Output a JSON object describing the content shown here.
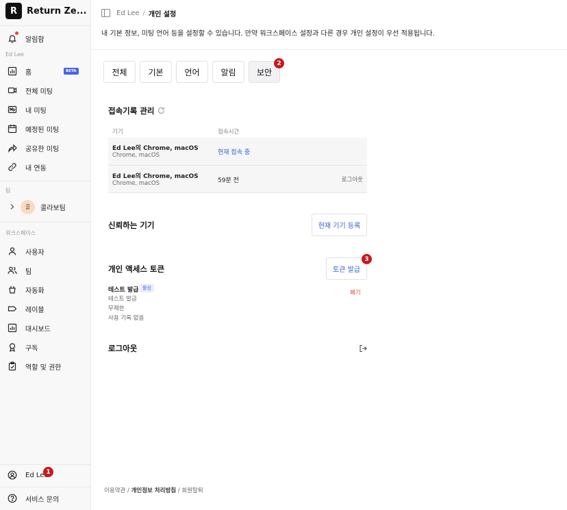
{
  "app": {
    "logo_letter": "R",
    "name": "Return Ze..."
  },
  "sidebar": {
    "notifications": "알림함",
    "user_section": "Ed Lee",
    "items": [
      {
        "label": "홈",
        "icon": "chart-icon",
        "badge": "BETA"
      },
      {
        "label": "전체 미팅",
        "icon": "video-icon"
      },
      {
        "label": "내 미팅",
        "icon": "mic-icon"
      },
      {
        "label": "예정된 미팅",
        "icon": "calendar-icon"
      },
      {
        "label": "공유한 미팅",
        "icon": "share-icon"
      },
      {
        "label": "내 연동",
        "icon": "link-icon"
      }
    ],
    "team_section": "팀",
    "team": {
      "avatar": "콜",
      "name": "콜라보팀"
    },
    "workspace_section": "워크스페이스",
    "workspace_items": [
      {
        "label": "사용자",
        "icon": "user-icon"
      },
      {
        "label": "팀",
        "icon": "users-icon"
      },
      {
        "label": "자동화",
        "icon": "automation-icon"
      },
      {
        "label": "레이블",
        "icon": "label-icon"
      },
      {
        "label": "대시보드",
        "icon": "dashboard-icon"
      },
      {
        "label": "구독",
        "icon": "badge-icon"
      },
      {
        "label": "역할 및 권한",
        "icon": "clipboard-icon"
      }
    ],
    "profile": "Ed Lee",
    "support": "서비스 문의"
  },
  "header": {
    "breadcrumb_user": "Ed Lee",
    "breadcrumb_sep": "/",
    "breadcrumb_page": "개인 설정",
    "description": "내 기본 정보, 미팅 언어 등을 설정할 수 있습니다. 만약 워크스페이스 설정과 다른 경우 개인 설정이 우선 적용됩니다."
  },
  "tabs": [
    {
      "label": "전체"
    },
    {
      "label": "기본"
    },
    {
      "label": "언어"
    },
    {
      "label": "알림"
    },
    {
      "label": "보안",
      "active": true
    }
  ],
  "badges": {
    "profile": "1",
    "security_tab": "2",
    "token_button": "3"
  },
  "access_log": {
    "title": "접속기록 관리",
    "col_device": "기기",
    "col_time": "접속시간",
    "rows": [
      {
        "device": "Ed Lee의 Chrome, macOS",
        "sub": "Chrome, macOS",
        "time": "현재 접속 중",
        "action": ""
      },
      {
        "device": "Ed Lee의 Chrome, macOS",
        "sub": "Chrome, macOS",
        "time": "59분 전",
        "action": "로그아웃"
      }
    ]
  },
  "trusted": {
    "title": "신뢰하는 기기",
    "button": "현재 기기 등록"
  },
  "token": {
    "title": "개인 액세스 토큰",
    "button": "토큰 발급",
    "name": "테스트 발급",
    "status": "활성",
    "line1": "테스트 발급",
    "line2": "무제한",
    "line3": "사용 기록 없음",
    "revoke": "폐기"
  },
  "logout": {
    "title": "로그아웃"
  },
  "footer": {
    "terms": "이용약관",
    "sep": "/",
    "privacy": "개인정보 처리방침",
    "withdraw": "회원탈퇴"
  },
  "colors": {
    "accent": "#2f62d8",
    "badge_red": "#c8191e",
    "beta": "#4a63e7",
    "revoke": "#e0483e"
  }
}
